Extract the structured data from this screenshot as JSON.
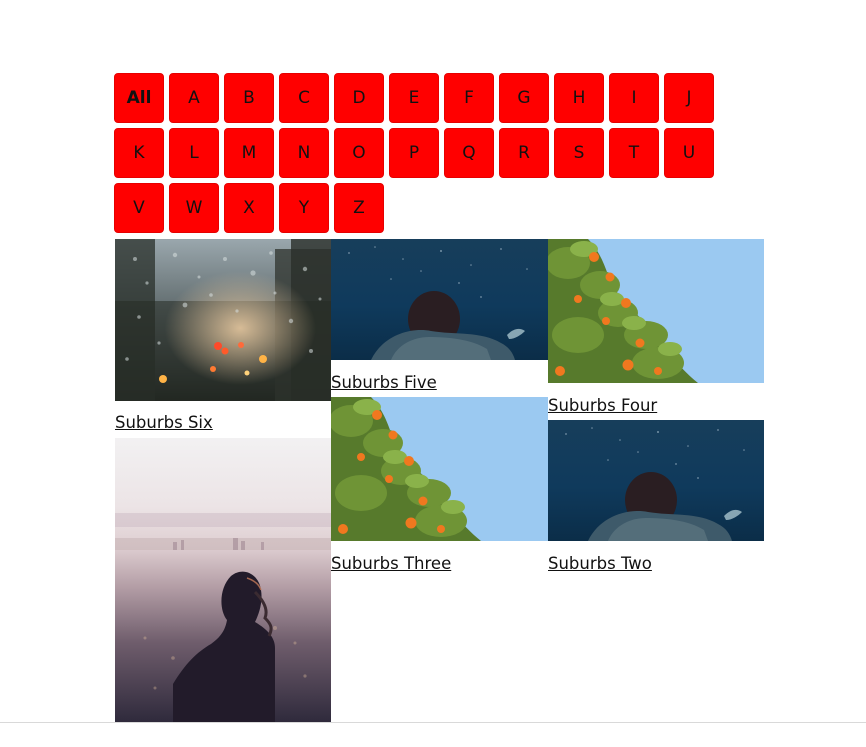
{
  "filter": {
    "buttons": [
      "All",
      "A",
      "B",
      "C",
      "D",
      "E",
      "F",
      "G",
      "H",
      "I",
      "J",
      "K",
      "L",
      "M",
      "N",
      "O",
      "P",
      "Q",
      "R",
      "S",
      "T",
      "U",
      "V",
      "W",
      "X",
      "Y",
      "Z"
    ],
    "active": "All",
    "color": "#ff0000"
  },
  "gallery": {
    "items": [
      {
        "title": "Suburbs Six",
        "image": "rain-window-city-lights"
      },
      {
        "title": "Suburbs Five",
        "image": "swimmer-underwater"
      },
      {
        "title": "Suburbs Four",
        "image": "orange-tree-sky"
      },
      {
        "title": "Suburbs Three",
        "image": "orange-tree-sky"
      },
      {
        "title": "Suburbs Two",
        "image": "swimmer-underwater"
      },
      {
        "title": "",
        "image": "woman-overlooking-city"
      }
    ]
  }
}
